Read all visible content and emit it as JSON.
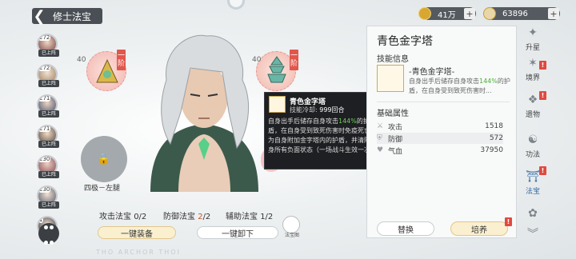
{
  "header": {
    "title": "修士法宝"
  },
  "resources": [
    {
      "name": "coin-icon",
      "value": "41万"
    },
    {
      "name": "jade-icon",
      "value": "63896"
    }
  ],
  "avatars": [
    {
      "level": "272",
      "tag": "已上阵"
    },
    {
      "level": "272",
      "tag": "已上阵"
    },
    {
      "level": "271",
      "tag": "已上阵"
    },
    {
      "level": "271",
      "tag": "已上阵"
    },
    {
      "level": "230",
      "tag": "已上阵"
    },
    {
      "level": "230",
      "tag": "已上阵"
    },
    {
      "level": "1",
      "tag": ""
    }
  ],
  "slots": {
    "left": {
      "level": "40",
      "tier": "一阶"
    },
    "right": {
      "level": "40",
      "tier": "一阶"
    },
    "locked_label": "四极－左腿"
  },
  "equip_counts": {
    "attack_label": "攻击法宝",
    "attack_value": "0/2",
    "defense_label": "防御法宝",
    "defense_value": "2",
    "defense_total": "/2",
    "support_label": "辅助法宝",
    "support_value": "1/2"
  },
  "buttons": {
    "equip_all": "一键装备",
    "unequip_all": "一键卸下",
    "treasure_small": "法宝图"
  },
  "tooltip": {
    "name": "青色金字塔",
    "cooldown_label": "技能冷却:",
    "cooldown_value": "999回合",
    "desc_a": "自身出手后储存自身攻击",
    "desc_pct": "144%",
    "desc_b": "的护盾，在自身受到致死伤害时免疫死亡并为自身附加金字塔内的护盾，并清除自身所有负面状态（一场战斗生效一次）"
  },
  "panel": {
    "title": "青色金字塔",
    "skill_header": "技能信息",
    "skill_name": "-青色金字塔-",
    "desc_a": "自身出手后储存自身攻击",
    "desc_pct": "144%",
    "desc_b": "的护盾，在自身受到致死伤害时...",
    "basic_header": "基础属性",
    "stats": [
      {
        "icon": "sword-icon",
        "label": "攻击",
        "value": "1518"
      },
      {
        "icon": "shield-icon",
        "label": "防御",
        "value": "572"
      },
      {
        "icon": "heart-icon",
        "label": "气血",
        "value": "37950"
      }
    ],
    "replace_label": "替换",
    "cultivate_label": "培养"
  },
  "nav": [
    {
      "label": "升星",
      "icon": "star-up-icon",
      "badge": false
    },
    {
      "label": "境界",
      "icon": "realm-icon",
      "badge": true
    },
    {
      "label": "遗物",
      "icon": "relic-icon",
      "badge": true
    },
    {
      "label": "功法",
      "icon": "technique-icon",
      "badge": false
    },
    {
      "label": "法宝",
      "icon": "treasure-icon",
      "badge": true,
      "active": true
    },
    {
      "label": "",
      "icon": "extra-icon",
      "badge": false
    }
  ],
  "watermark": "THO ARCHOR THOI",
  "colors": {
    "accent": "#3a6ea5",
    "red_badge": "#e04a3f",
    "green": "#4caf3a",
    "tooltip_bg": "#1e1f22"
  }
}
